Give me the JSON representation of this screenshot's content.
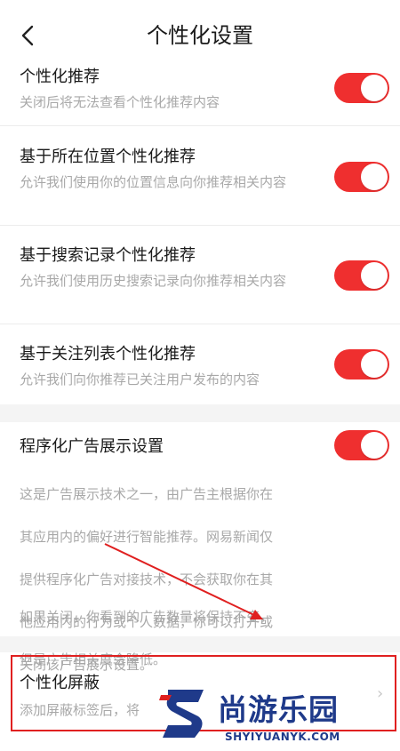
{
  "header": {
    "title": "个性化设置",
    "back_icon": "chevron-left-icon"
  },
  "settings": [
    {
      "title": "个性化推荐",
      "desc": "关闭后将无法查看个性化推荐内容",
      "enabled": true
    },
    {
      "title": "基于所在位置个性化推荐",
      "desc": "允许我们使用你的位置信息向你推荐相关内容",
      "enabled": true
    },
    {
      "title": "基于搜索记录个性化推荐",
      "desc": "允许我们使用历史搜索记录向你推荐相关内容",
      "enabled": true
    },
    {
      "title": "基于关注列表个性化推荐",
      "desc": "允许我们向你推荐已关注用户发布的内容",
      "enabled": true
    }
  ],
  "ad_setting": {
    "title": "程序化广告展示设置",
    "desc_lines": [
      "这是广告展示技术之一，由广告主根据你在",
      "其应用内的偏好进行智能推荐。网易新闻仅",
      "提供程序化广告对接技术，不会获取你在其",
      "他应用内的行为或个人数据，你可以打开或",
      "关闭该广告展示设置。"
    ],
    "note_lines": [
      "如果关闭，你看到的广告数量将保持不变，",
      "但是广告相关度会降低。"
    ],
    "enabled": true
  },
  "block_setting": {
    "title": "个性化屏蔽",
    "desc": "添加屏蔽标签后，将"
  },
  "watermark": {
    "brand": "尚游乐园",
    "url": "SHYIYUANYK.COM"
  },
  "colors": {
    "toggle_on": "#ef2f2f",
    "annotation": "#e02020",
    "watermark": "#1f3a8a"
  }
}
